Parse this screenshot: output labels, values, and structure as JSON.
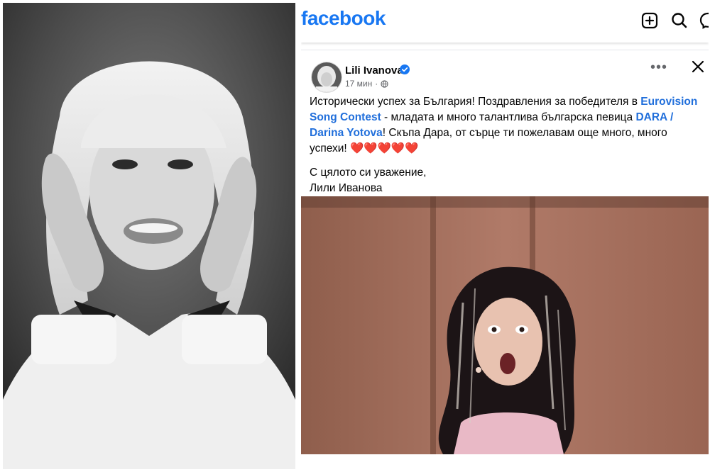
{
  "header": {
    "logo": "facebook",
    "icons": [
      "plus-square-icon",
      "search-icon",
      "messenger-icon"
    ]
  },
  "post": {
    "author": "Lili Ivanova",
    "verified": true,
    "time": "17 мин",
    "text_parts": {
      "p1": "Исторически успех за България! Поздравления за победителя в ",
      "link1": "Eurovision Song Contest",
      "p2": " - младата и много талантлива българска певица ",
      "link2": "DARA / Darina Yotova",
      "p3": "! Скъпа Дара, от сърце ти пожелавам още много, много успехи! ",
      "hearts": "❤️❤️❤️❤️❤️"
    },
    "signoff_line1": "С цялото си уважение,",
    "signoff_line2": "Лили Иванова",
    "more_label": "•••",
    "close_label": "×"
  },
  "colors": {
    "brand": "#1877f2",
    "link": "#216fdb",
    "heart": "#e0242e"
  }
}
